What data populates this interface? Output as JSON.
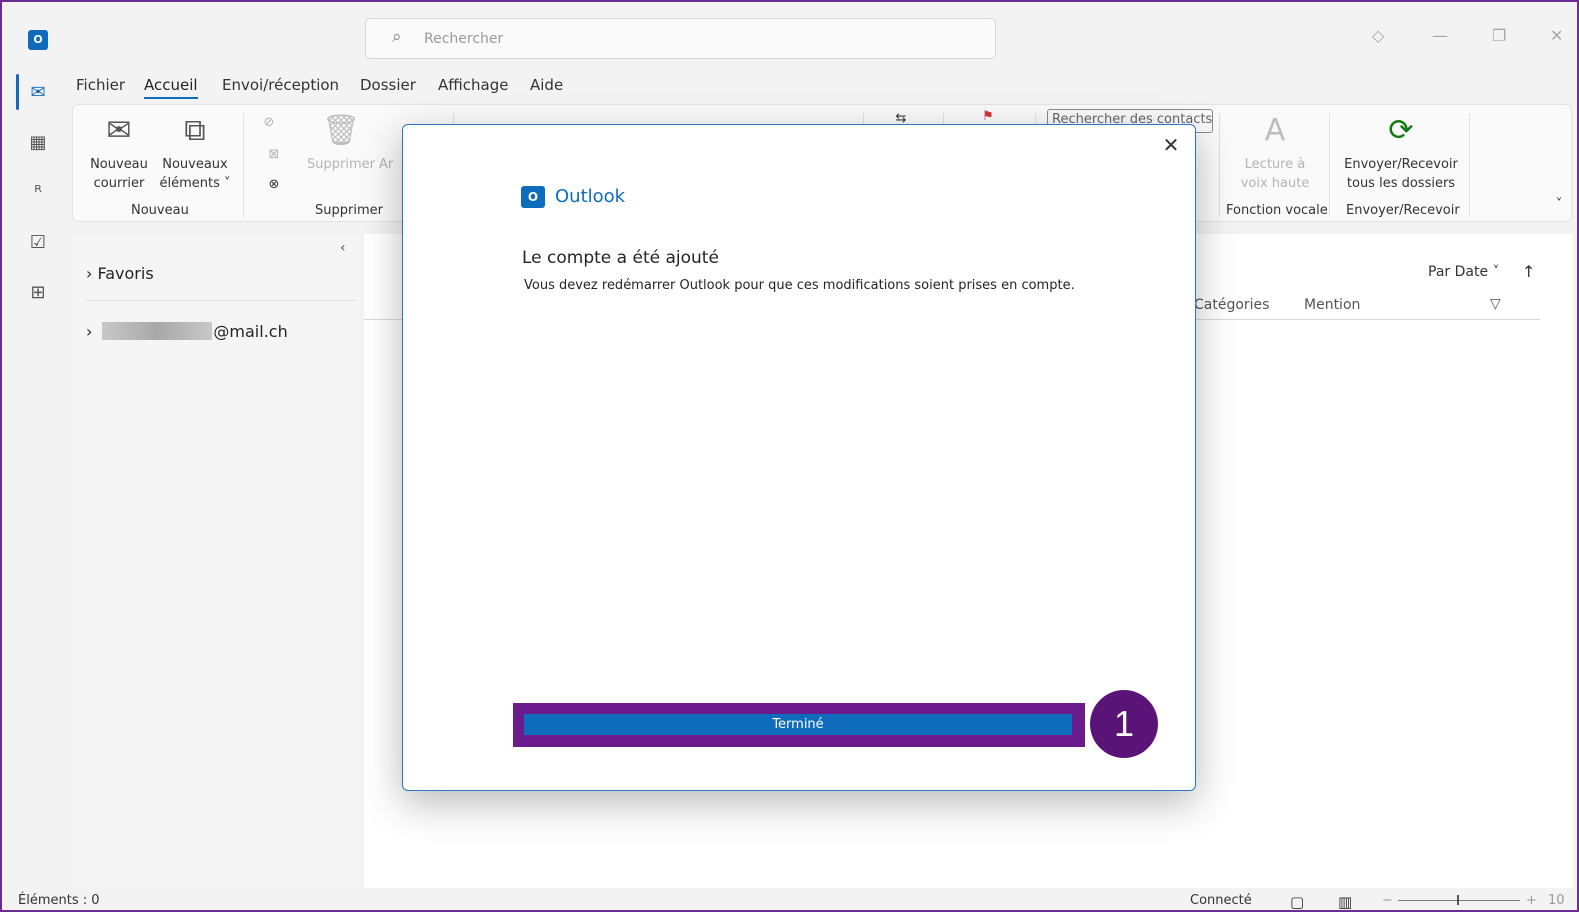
{
  "titlebar": {
    "search_placeholder": "Rechercher"
  },
  "menu": {
    "tabs": [
      {
        "label": "Fichier"
      },
      {
        "label": "Accueil"
      },
      {
        "label": "Envoi/réception"
      },
      {
        "label": "Dossier"
      },
      {
        "label": "Affichage"
      },
      {
        "label": "Aide"
      }
    ]
  },
  "ribbon": {
    "new_mail_line1": "Nouveau",
    "new_mail_line2": "courrier",
    "new_items_line1": "Nouveaux",
    "new_items_line2": "éléments",
    "delete_label": "Supprimer",
    "archive_label": "Ar",
    "group_new": "Nouveau",
    "group_delete": "Supprimer",
    "contacts_search": "Rechercher des contacts",
    "read_aloud_line1": "Lecture à",
    "read_aloud_line2": "voix haute",
    "group_voice": "Fonction vocale",
    "send_receive_line1": "Envoyer/Recevoir",
    "send_receive_line2": "tous les dossiers",
    "group_send_receive": "Envoyer/Recevoir"
  },
  "folders": {
    "favorites": "Favoris",
    "account_suffix": "@mail.ch"
  },
  "maillist": {
    "sort_label": "Par Date",
    "col_categories": "Catégories",
    "col_mention": "Mention"
  },
  "status": {
    "items": "Éléments : 0",
    "connected": "Connecté",
    "zoom": "10"
  },
  "modal": {
    "brand": "Outlook",
    "heading": "Le compte a été ajouté",
    "body": "Vous devez redémarrer Outlook pour que ces modifications soient prises en compte.",
    "done_label": "Terminé",
    "step_number": "1"
  }
}
